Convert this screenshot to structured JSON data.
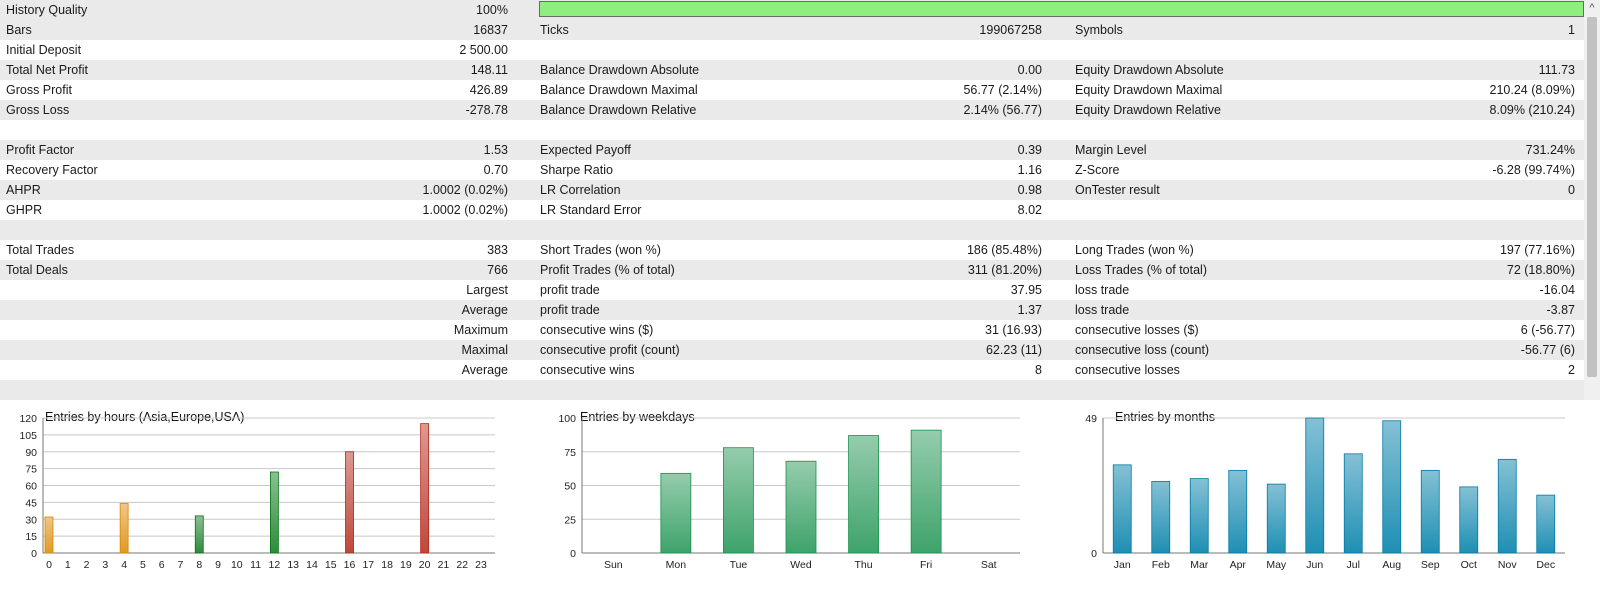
{
  "report": {
    "rows": [
      {
        "c0": "History Quality",
        "c1": "100%",
        "c2": "",
        "c3": "",
        "c4": "",
        "c5": ""
      },
      {
        "c0": "Bars",
        "c1": "16837",
        "c2": "Ticks",
        "c3": "199067258",
        "c4": "Symbols",
        "c5": "1"
      },
      {
        "c0": "Initial Deposit",
        "c1": "2 500.00",
        "c2": "",
        "c3": "",
        "c4": "",
        "c5": ""
      },
      {
        "c0": "Total Net Profit",
        "c1": "148.11",
        "c2": "Balance Drawdown Absolute",
        "c3": "0.00",
        "c4": "Equity Drawdown Absolute",
        "c5": "111.73"
      },
      {
        "c0": "Gross Profit",
        "c1": "426.89",
        "c2": "Balance Drawdown Maximal",
        "c3": "56.77 (2.14%)",
        "c4": "Equity Drawdown Maximal",
        "c5": "210.24 (8.09%)"
      },
      {
        "c0": "Gross Loss",
        "c1": "-278.78",
        "c2": "Balance Drawdown Relative",
        "c3": "2.14% (56.77)",
        "c4": "Equity Drawdown Relative",
        "c5": "8.09% (210.24)"
      },
      {
        "c0": "",
        "c1": "",
        "c2": "",
        "c3": "",
        "c4": "",
        "c5": ""
      },
      {
        "c0": "Profit Factor",
        "c1": "1.53",
        "c2": "Expected Payoff",
        "c3": "0.39",
        "c4": "Margin Level",
        "c5": "731.24%"
      },
      {
        "c0": "Recovery Factor",
        "c1": "0.70",
        "c2": "Sharpe Ratio",
        "c3": "1.16",
        "c4": "Z-Score",
        "c5": "-6.28 (99.74%)"
      },
      {
        "c0": "AHPR",
        "c1": "1.0002 (0.02%)",
        "c2": "LR Correlation",
        "c3": "0.98",
        "c4": "OnTester result",
        "c5": "0"
      },
      {
        "c0": "GHPR",
        "c1": "1.0002 (0.02%)",
        "c2": "LR Standard Error",
        "c3": "8.02",
        "c4": "",
        "c5": ""
      },
      {
        "c0": "",
        "c1": "",
        "c2": "",
        "c3": "",
        "c4": "",
        "c5": ""
      },
      {
        "c0": "Total Trades",
        "c1": "383",
        "c2": "Short Trades (won %)",
        "c3": "186 (85.48%)",
        "c4": "Long Trades (won %)",
        "c5": "197 (77.16%)"
      },
      {
        "c0": "Total Deals",
        "c1": "766",
        "c2": "Profit Trades (% of total)",
        "c3": "311 (81.20%)",
        "c4": "Loss Trades (% of total)",
        "c5": "72 (18.80%)"
      },
      {
        "c0": "",
        "c1": "Largest",
        "c2": "profit trade",
        "c3": "37.95",
        "c4": "loss trade",
        "c5": "-16.04"
      },
      {
        "c0": "",
        "c1": "Average",
        "c2": "profit trade",
        "c3": "1.37",
        "c4": "loss trade",
        "c5": "-3.87"
      },
      {
        "c0": "",
        "c1": "Maximum",
        "c2": "consecutive wins ($)",
        "c3": "31 (16.93)",
        "c4": "consecutive losses ($)",
        "c5": "6 (-56.77)"
      },
      {
        "c0": "",
        "c1": "Maximal",
        "c2": "consecutive profit (count)",
        "c3": "62.23 (11)",
        "c4": "consecutive loss (count)",
        "c5": "-56.77 (6)"
      },
      {
        "c0": "",
        "c1": "Average",
        "c2": "consecutive wins",
        "c3": "8",
        "c4": "consecutive losses",
        "c5": "2"
      },
      {
        "c0": "",
        "c1": "",
        "c2": "",
        "c3": "",
        "c4": "",
        "c5": ""
      }
    ],
    "history_quality_fraction": 1.0,
    "history_quality_color": "#90ee80",
    "shade_color": "#eaeaea",
    "scroll_up_icon": "chevron-up-icon",
    "scroll_up_glyph": "^"
  },
  "chart_data": [
    {
      "type": "bar",
      "title": "Entries by hours (Asia,Europe,USA)",
      "categories": [
        "0",
        "1",
        "2",
        "3",
        "4",
        "5",
        "6",
        "7",
        "8",
        "9",
        "10",
        "11",
        "12",
        "13",
        "14",
        "15",
        "16",
        "17",
        "18",
        "19",
        "20",
        "21",
        "22",
        "23"
      ],
      "values": [
        32,
        0,
        0,
        0,
        44,
        0,
        0,
        0,
        33,
        0,
        0,
        0,
        72,
        0,
        0,
        0,
        90,
        0,
        0,
        0,
        115,
        0,
        0,
        0
      ],
      "ylim": [
        0,
        120
      ],
      "yticks": [
        "0",
        "15",
        "30",
        "45",
        "60",
        "75",
        "90",
        "105",
        "120"
      ],
      "colors": [
        "#e09a24",
        "#e09a24",
        "#e09a24",
        "#e09a24",
        "#e09a24",
        "#e09a24",
        "#e09a24",
        "#e09a24",
        "#2e8b3a",
        "#2e8b3a",
        "#2e8b3a",
        "#2e8b3a",
        "#2e8b3a",
        "#2e8b3a",
        "#2e8b3a",
        "#2e8b3a",
        "#c0473c",
        "#c0473c",
        "#c0473c",
        "#c0473c",
        "#c0473c",
        "#c0473c",
        "#c0473c",
        "#c0473c"
      ],
      "grid": true
    },
    {
      "type": "bar",
      "title": "Entries by weekdays",
      "categories": [
        "Sun",
        "Mon",
        "Tue",
        "Wed",
        "Thu",
        "Fri",
        "Sat"
      ],
      "values": [
        0,
        59,
        78,
        68,
        87,
        91,
        0
      ],
      "ylim": [
        0,
        100
      ],
      "yticks": [
        "0",
        "25",
        "50",
        "75",
        "100"
      ],
      "colors": [
        "#3ea36a",
        "#3ea36a",
        "#3ea36a",
        "#3ea36a",
        "#3ea36a",
        "#3ea36a",
        "#3ea36a"
      ],
      "grid": true
    },
    {
      "type": "bar",
      "title": "Entries by months",
      "categories": [
        "Jan",
        "Feb",
        "Mar",
        "Apr",
        "May",
        "Jun",
        "Jul",
        "Aug",
        "Sep",
        "Oct",
        "Nov",
        "Dec"
      ],
      "values": [
        32,
        26,
        27,
        30,
        25,
        49,
        36,
        48,
        30,
        24,
        34,
        21
      ],
      "ylim": [
        0,
        49
      ],
      "yticks": [
        "0",
        "49"
      ],
      "colors": [
        "#1f8fb3",
        "#1f8fb3",
        "#1f8fb3",
        "#1f8fb3",
        "#1f8fb3",
        "#1f8fb3",
        "#1f8fb3",
        "#1f8fb3",
        "#1f8fb3",
        "#1f8fb3",
        "#1f8fb3",
        "#1f8fb3"
      ],
      "grid": true
    }
  ]
}
